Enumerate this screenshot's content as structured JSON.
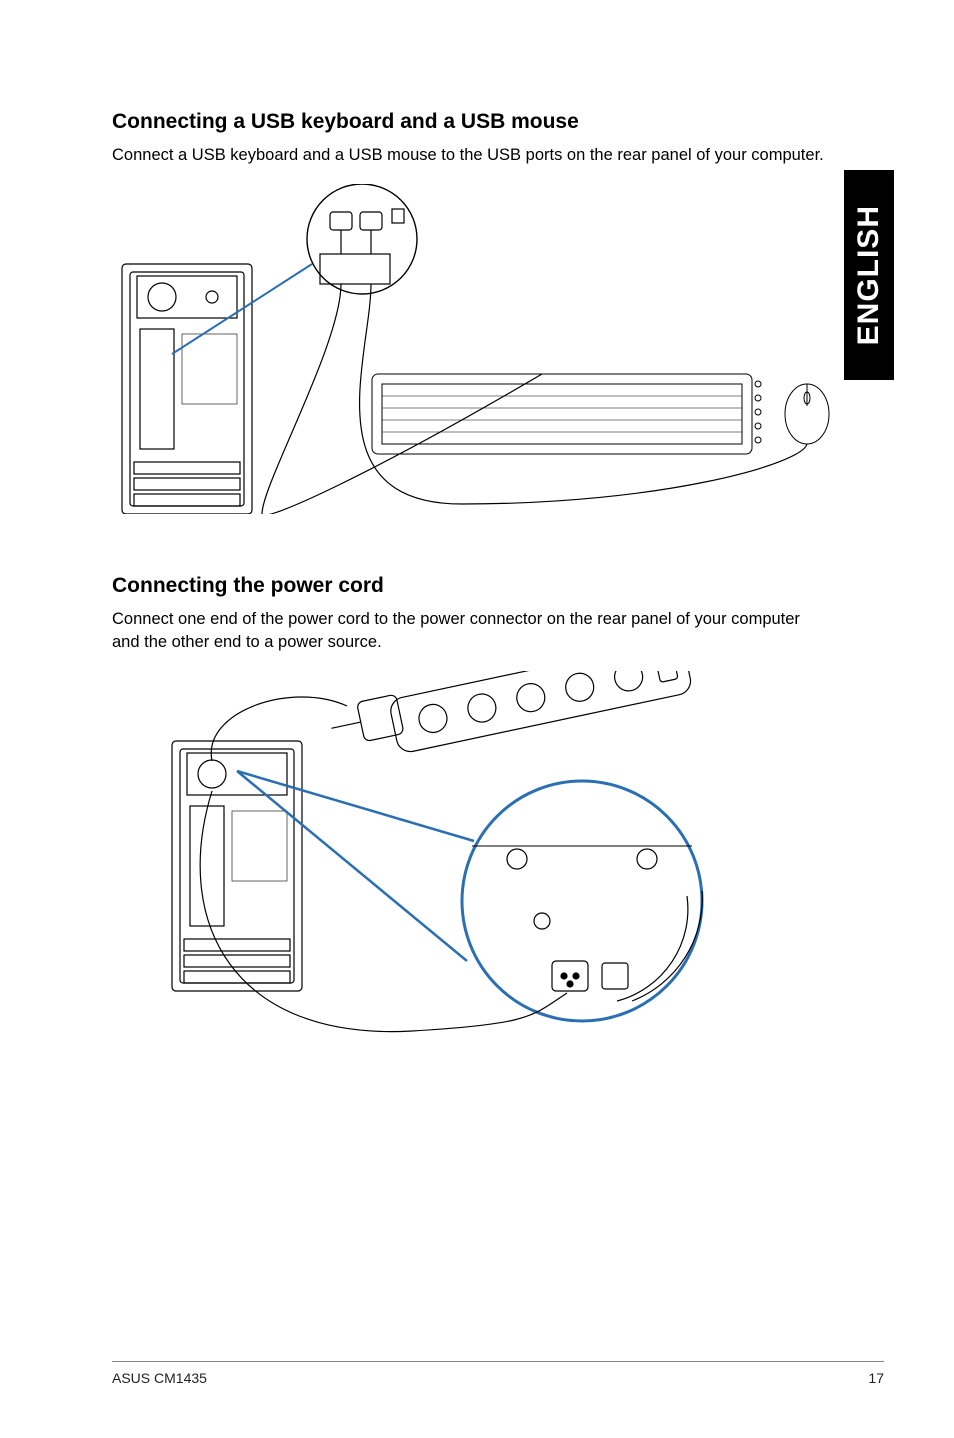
{
  "sidebar": {
    "language": "ENGLISH"
  },
  "section1": {
    "heading": "Connecting a USB keyboard and a USB mouse",
    "body": "Connect a USB keyboard and a USB mouse to the USB ports on the rear panel of your computer."
  },
  "section2": {
    "heading": "Connecting the power cord",
    "body": "Connect one end of the power cord to the power connector on the rear panel of your computer and the other end to a power source."
  },
  "footer": {
    "left": "ASUS CM1435",
    "right": "17"
  }
}
